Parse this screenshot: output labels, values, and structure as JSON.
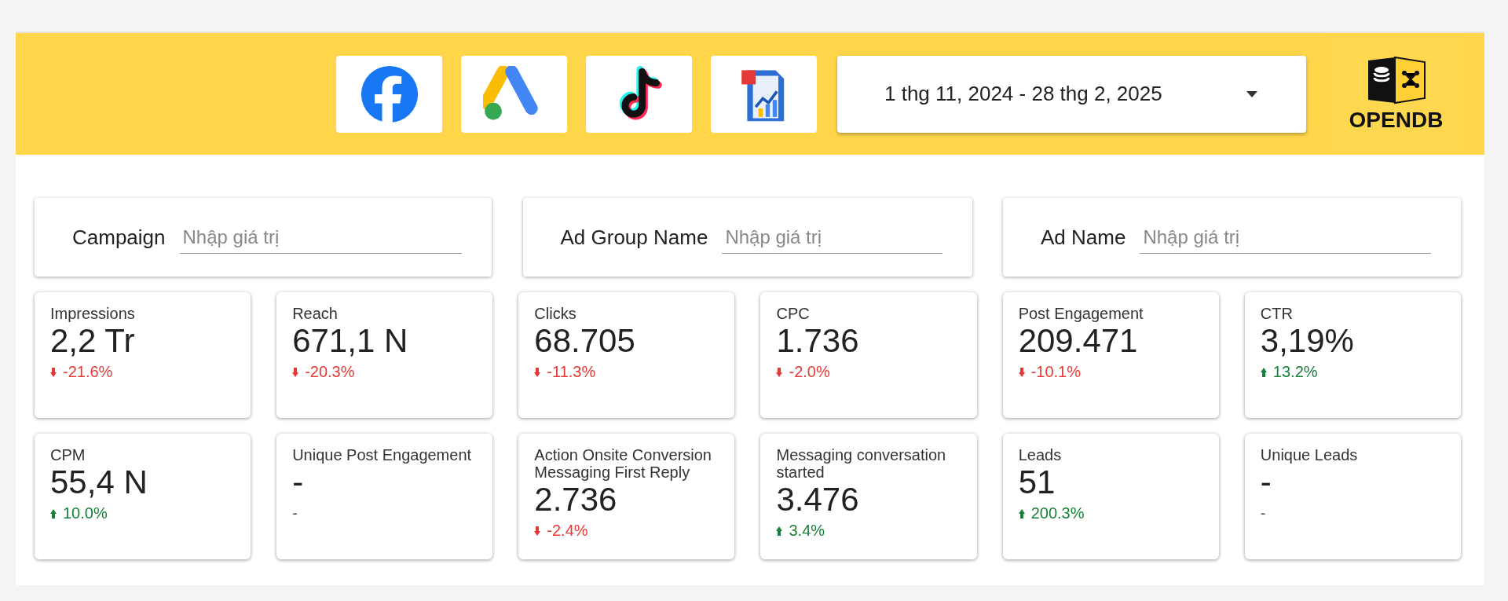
{
  "header": {
    "sources": [
      {
        "kind": "facebook",
        "selected": false
      },
      {
        "kind": "google-ads",
        "selected": false
      },
      {
        "kind": "tiktok",
        "selected": false
      },
      {
        "kind": "report",
        "selected": false
      }
    ],
    "date_range": {
      "value": "1 thg 11, 2024 - 28 thg 2, 2025"
    },
    "logo": {
      "text": "OPENDB"
    }
  },
  "filters": [
    {
      "label": "Campaign",
      "placeholder": "Nhập giá trị"
    },
    {
      "label": "Ad Group Name",
      "placeholder": "Nhập giá trị"
    },
    {
      "label": "Ad Name",
      "placeholder": "Nhập giá trị"
    }
  ],
  "metrics": [
    {
      "label": "Impressions",
      "value": "2,2 Tr",
      "change": "-21.6%",
      "kind": "down"
    },
    {
      "label": "Reach",
      "value": "671,1 N",
      "change": "-20.3%",
      "kind": "down"
    },
    {
      "label": "Clicks",
      "value": "68.705",
      "change": "-11.3%",
      "kind": "down"
    },
    {
      "label": "CPC",
      "value": "1.736",
      "change": "-2.0%",
      "kind": "down"
    },
    {
      "label": "Post Engagement",
      "value": "209.471",
      "change": "-10.1%",
      "kind": "down"
    },
    {
      "label": "CTR",
      "value": "3,19%",
      "change": "13.2%",
      "kind": "up"
    },
    {
      "label": "CPM",
      "value": "55,4 N",
      "change": "10.0%",
      "kind": "up"
    },
    {
      "label": "Unique Post Engagement",
      "value": "-",
      "change": "-",
      "kind": "none"
    },
    {
      "label": "Action Onsite Conversion Messaging First Reply",
      "value": "2.736",
      "change": "-2.4%",
      "kind": "down"
    },
    {
      "label": "Messaging conversation started",
      "value": "3.476",
      "change": "3.4%",
      "kind": "up"
    },
    {
      "label": "Leads",
      "value": "51",
      "change": "200.3%",
      "kind": "up"
    },
    {
      "label": "Unique Leads",
      "value": "-",
      "change": "-",
      "kind": "none"
    }
  ]
}
